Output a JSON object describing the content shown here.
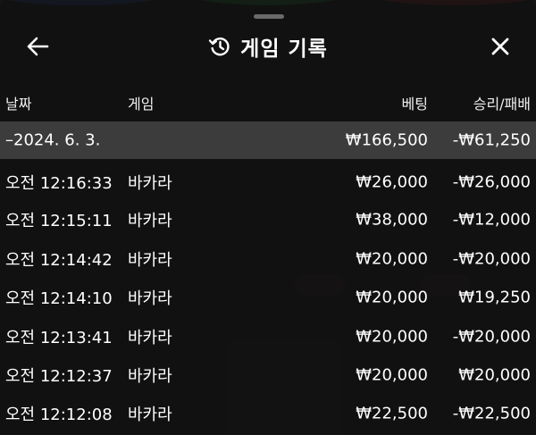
{
  "header": {
    "title": "게임 기록",
    "back_icon": "arrow-left-icon",
    "history_icon": "history-icon",
    "close_icon": "close-icon"
  },
  "columns": {
    "date": "날짜",
    "game": "게임",
    "bet": "베팅",
    "result": "승리/패배"
  },
  "summary": {
    "date": "–2024. 6. 3.",
    "bet": "₩166,500",
    "result": "-₩61,250"
  },
  "rows": [
    {
      "time": "오전 12:16:33",
      "game": "바카라",
      "bet": "₩26,000",
      "result": "-₩26,000"
    },
    {
      "time": "오전 12:15:11",
      "game": "바카라",
      "bet": "₩38,000",
      "result": "-₩12,000"
    },
    {
      "time": "오전 12:14:42",
      "game": "바카라",
      "bet": "₩20,000",
      "result": "-₩20,000"
    },
    {
      "time": "오전 12:14:10",
      "game": "바카라",
      "bet": "₩20,000",
      "result": "₩19,250"
    },
    {
      "time": "오전 12:13:41",
      "game": "바카라",
      "bet": "₩20,000",
      "result": "-₩20,000"
    },
    {
      "time": "오전 12:12:37",
      "game": "바카라",
      "bet": "₩20,000",
      "result": "₩20,000"
    },
    {
      "time": "오전 12:12:08",
      "game": "바카라",
      "bet": "₩22,500",
      "result": "-₩22,500"
    }
  ],
  "colors": {
    "summary_row": "#3c3c3c",
    "panel": "#141414",
    "text": "#ffffff"
  }
}
